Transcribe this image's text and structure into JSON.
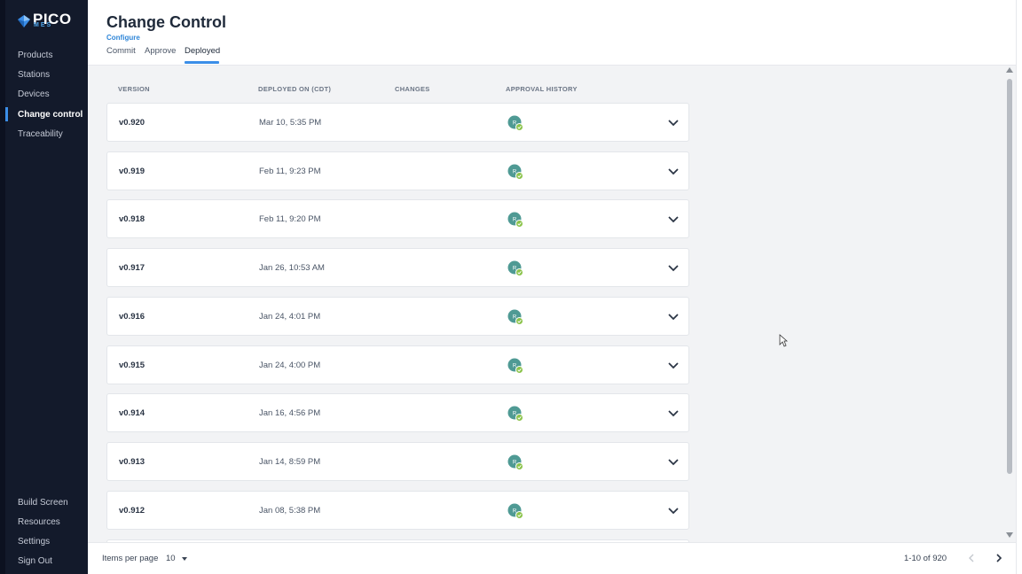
{
  "sidebar": {
    "logo_text": "PICO",
    "logo_sub": "MES",
    "nav": [
      {
        "label": "Products"
      },
      {
        "label": "Stations"
      },
      {
        "label": "Devices"
      },
      {
        "label": "Change control"
      },
      {
        "label": "Traceability"
      }
    ],
    "bottom": [
      {
        "label": "Build Screen"
      },
      {
        "label": "Resources"
      },
      {
        "label": "Settings"
      },
      {
        "label": "Sign Out"
      }
    ]
  },
  "header": {
    "title": "Change Control",
    "subtitle": "Configure",
    "tabs": [
      {
        "label": "Commit"
      },
      {
        "label": "Approve"
      },
      {
        "label": "Deployed"
      }
    ]
  },
  "table": {
    "columns": [
      "VERSION",
      "DEPLOYED ON (CDT)",
      "CHANGES",
      "APPROVAL HISTORY"
    ],
    "rows": [
      {
        "version": "v0.920",
        "deployed_on": "Mar 10, 5:35 PM",
        "approver_initial": "R"
      },
      {
        "version": "v0.919",
        "deployed_on": "Feb 11, 9:23 PM",
        "approver_initial": "R"
      },
      {
        "version": "v0.918",
        "deployed_on": "Feb 11, 9:20 PM",
        "approver_initial": "R"
      },
      {
        "version": "v0.917",
        "deployed_on": "Jan 26, 10:53 AM",
        "approver_initial": "R"
      },
      {
        "version": "v0.916",
        "deployed_on": "Jan 24, 4:01 PM",
        "approver_initial": "R"
      },
      {
        "version": "v0.915",
        "deployed_on": "Jan 24, 4:00 PM",
        "approver_initial": "R"
      },
      {
        "version": "v0.914",
        "deployed_on": "Jan 16, 4:56 PM",
        "approver_initial": "R"
      },
      {
        "version": "v0.913",
        "deployed_on": "Jan 14, 8:59 PM",
        "approver_initial": "R"
      },
      {
        "version": "v0.912",
        "deployed_on": "Jan 08, 5:38 PM",
        "approver_initial": "R"
      }
    ]
  },
  "footer": {
    "items_per_page_label": "Items per page",
    "items_per_page_value": "10",
    "range_text": "1-10 of 920"
  },
  "colors": {
    "sidebar_bg": "#131a2b",
    "accent": "#3b8ee8",
    "content_bg": "#f2f3f5",
    "avatar": "#4f9a94",
    "approved_check": "#8bc34a"
  },
  "icons": {
    "logo": "diamond-logo-icon",
    "row_expand": "chevron-down-icon",
    "approver": "avatar-icon",
    "approved": "check-badge-icon",
    "prev_page": "chevron-left-icon",
    "next_page": "chevron-right-icon"
  }
}
